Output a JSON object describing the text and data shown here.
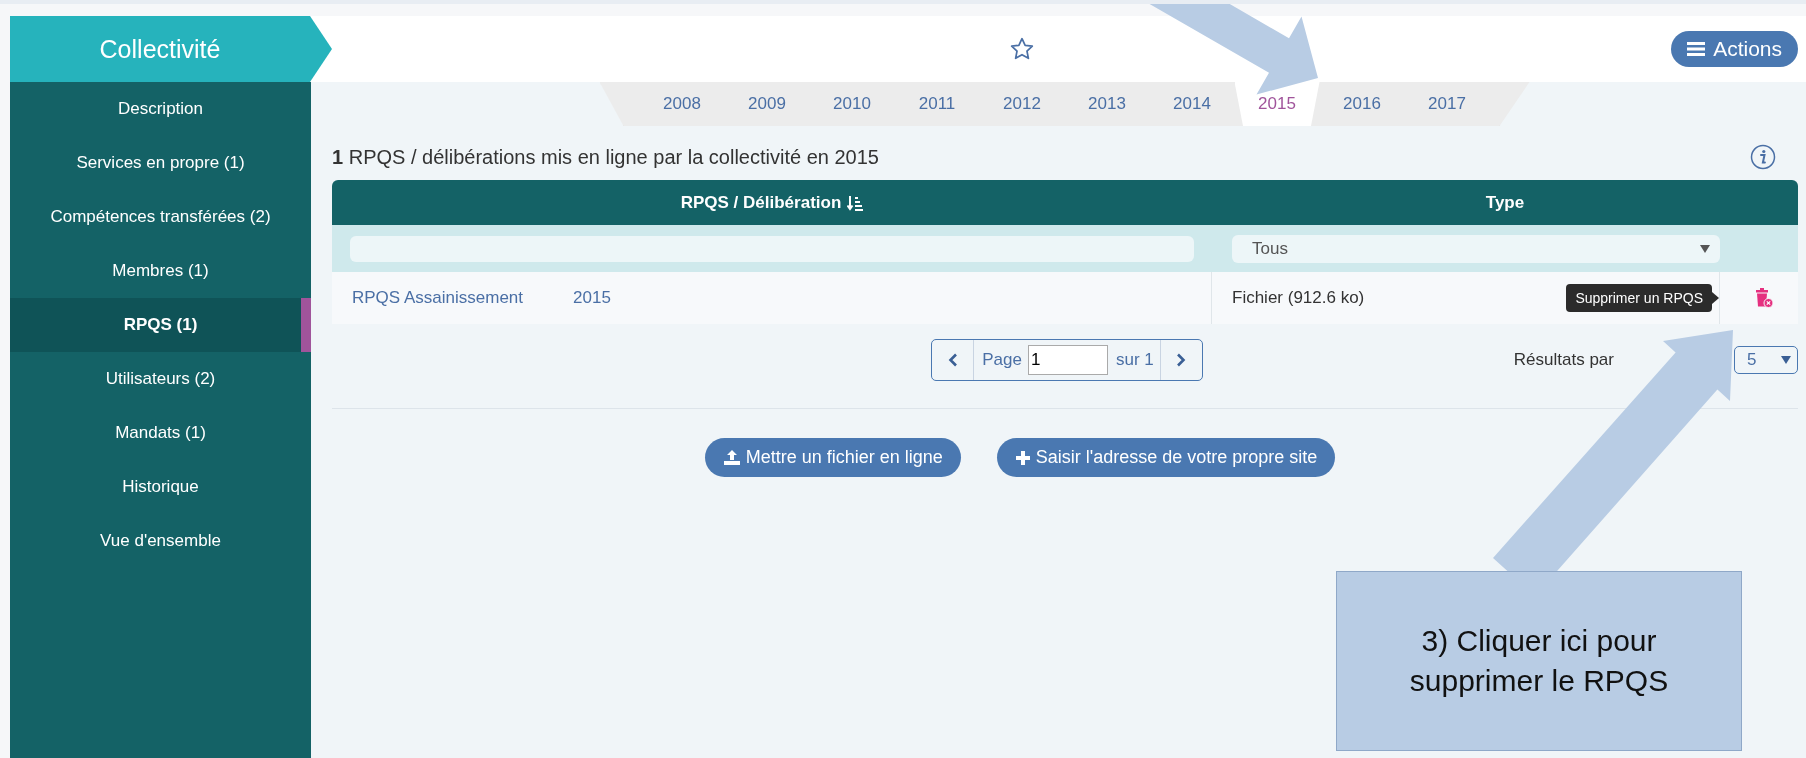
{
  "sidebar": {
    "title": "Collectivité",
    "items": [
      {
        "label": "Description",
        "selected": false
      },
      {
        "label": "Services en propre (1)",
        "selected": false
      },
      {
        "label": "Compétences transférées (2)",
        "selected": false
      },
      {
        "label": "Membres (1)",
        "selected": false
      },
      {
        "label": "RPQS (1)",
        "selected": true
      },
      {
        "label": "Utilisateurs (2)",
        "selected": false
      },
      {
        "label": "Mandats (1)",
        "selected": false
      },
      {
        "label": "Historique",
        "selected": false
      },
      {
        "label": "Vue d'ensemble",
        "selected": false
      }
    ]
  },
  "toolbar": {
    "actions_label": "Actions"
  },
  "year_tabs": [
    {
      "label": "2008",
      "selected": false
    },
    {
      "label": "2009",
      "selected": false
    },
    {
      "label": "2010",
      "selected": false
    },
    {
      "label": "2011",
      "selected": false
    },
    {
      "label": "2012",
      "selected": false
    },
    {
      "label": "2013",
      "selected": false
    },
    {
      "label": "2014",
      "selected": false
    },
    {
      "label": "2015",
      "selected": true
    },
    {
      "label": "2016",
      "selected": false
    },
    {
      "label": "2017",
      "selected": false
    }
  ],
  "heading": "**1** RPQS / délibérations mis en ligne par la collectivité en 2015",
  "table": {
    "columns": [
      "RPQS / Délibération",
      "Type"
    ],
    "filter_type": "Tous",
    "rows": [
      {
        "name": "RPQS Assainissement",
        "year": "2015",
        "type": "Fichier (912.6 ko)",
        "tooltip": "Supprimer un RPQS"
      }
    ]
  },
  "pagination": {
    "page_label": "Page",
    "page": "1",
    "total": "sur 1",
    "per_page_label": "Résultats par",
    "per_page": "5"
  },
  "buttons": [
    {
      "kind": "upload",
      "label": "Mettre un fichier en ligne"
    },
    {
      "kind": "add",
      "label": "Saisir l'adresse de votre propre site"
    }
  ],
  "callout": {
    "text": "3) Cliquer ici pour supprimer le RPQS"
  }
}
